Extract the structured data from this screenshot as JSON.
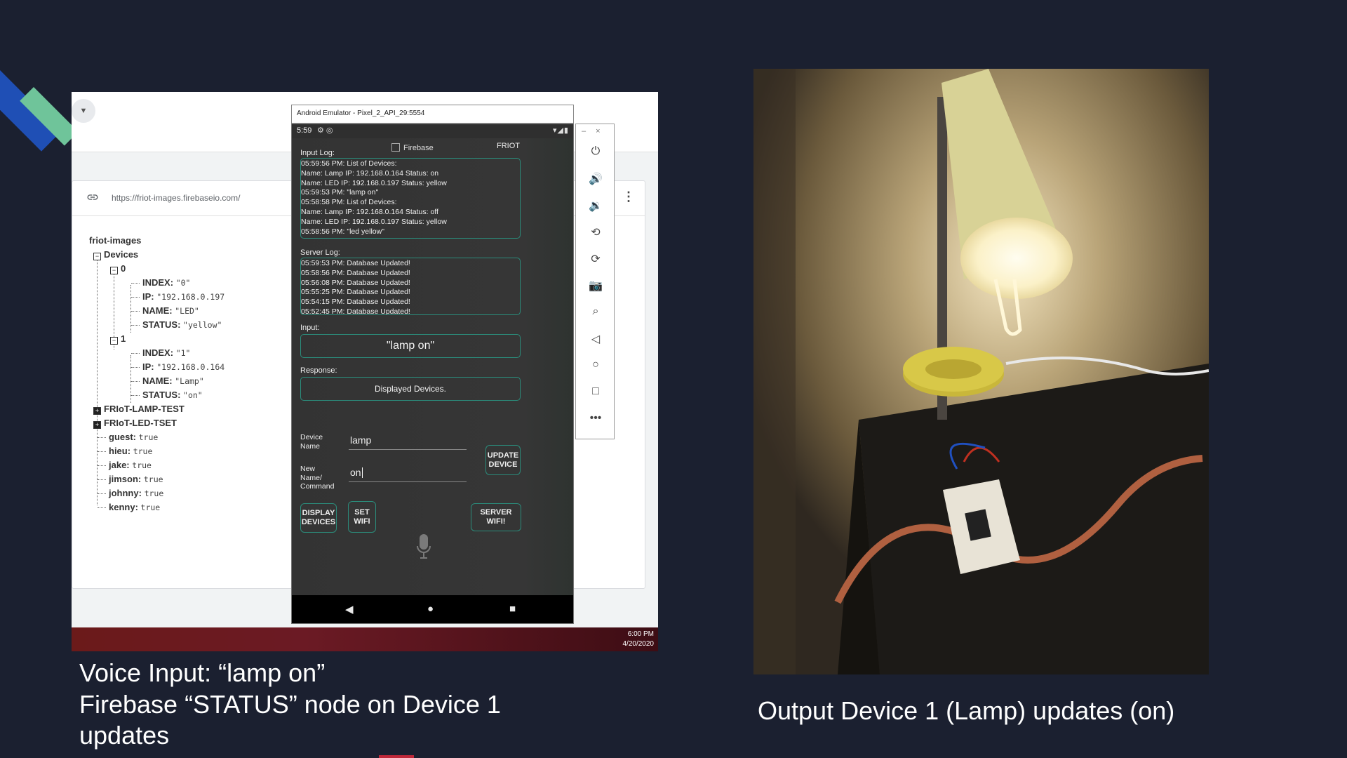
{
  "firebase": {
    "url": "https://friot-images.firebaseio.com/",
    "tree": {
      "root": "friot-images",
      "devices_label": "Devices",
      "node0": "0",
      "node0_fields": [
        {
          "key": "INDEX:",
          "value": "\"0\""
        },
        {
          "key": "IP:",
          "value": "\"192.168.0.197"
        },
        {
          "key": "NAME:",
          "value": "\"LED\""
        },
        {
          "key": "STATUS:",
          "value": "\"yellow\""
        }
      ],
      "node1": "1",
      "node1_fields": [
        {
          "key": "INDEX:",
          "value": "\"1\""
        },
        {
          "key": "IP:",
          "value": "\"192.168.0.164"
        },
        {
          "key": "NAME:",
          "value": "\"Lamp\""
        },
        {
          "key": "STATUS:",
          "value": "\"on\""
        }
      ],
      "collapsed": [
        "FRIoT-LAMP-TEST",
        "FRIoT-LED-TSET"
      ],
      "users": [
        {
          "key": "guest:",
          "value": "true"
        },
        {
          "key": "hieu:",
          "value": "true"
        },
        {
          "key": "jake:",
          "value": "true"
        },
        {
          "key": "jimson:",
          "value": "true"
        },
        {
          "key": "johnny:",
          "value": "true"
        },
        {
          "key": "kenny:",
          "value": "true"
        }
      ]
    }
  },
  "taskbar": {
    "time": "6:00 PM",
    "date": "4/20/2020"
  },
  "emulator": {
    "title": "Android Emulator - Pixel_2_API_29:5554",
    "status_time": "5:59",
    "firebase_checkbox": "Firebase",
    "app_name": "FRIOT",
    "input_log_label": "Input Log:",
    "input_log": [
      "05:59:56 PM: List of Devices:",
      "Name: Lamp  IP: 192.168.0.164  Status: on",
      "Name: LED  IP: 192.168.0.197  Status: yellow",
      "05:59:53 PM: \"lamp on\"",
      "05:58:58 PM: List of Devices:",
      "Name: Lamp  IP: 192.168.0.164  Status: off",
      "Name: LED  IP: 192.168.0.197  Status: yellow",
      "05:58:56 PM: \"led yellow\""
    ],
    "server_log_label": "Server Log:",
    "server_log": [
      "05:59:53 PM: Database Updated!",
      "05:58:56 PM: Database Updated!",
      "05:56:08 PM: Database Updated!",
      "05:55:25 PM: Database Updated!",
      "05:54:15 PM: Database Updated!",
      "05:52:45 PM: Database Updated!"
    ],
    "input_label": "Input:",
    "input_value": "\"lamp on\"",
    "response_label": "Response:",
    "response_value": "Displayed Devices.",
    "device_name_label": "Device\nName",
    "device_name_value": "lamp",
    "new_name_label": "New\nName/\nCommand",
    "new_name_value": "on",
    "update_button": "UPDATE\nDEVICE",
    "display_button": "DISPLAY\nDEVICES",
    "set_wifi_button": "SET\nWIFI",
    "server_wifi_button": "SERVER WIFI!"
  },
  "captions": {
    "left": "Voice Input: “lamp on”\nFirebase “STATUS” node on Device 1\nupdates",
    "right": "Output Device 1 (Lamp) updates (on)"
  }
}
